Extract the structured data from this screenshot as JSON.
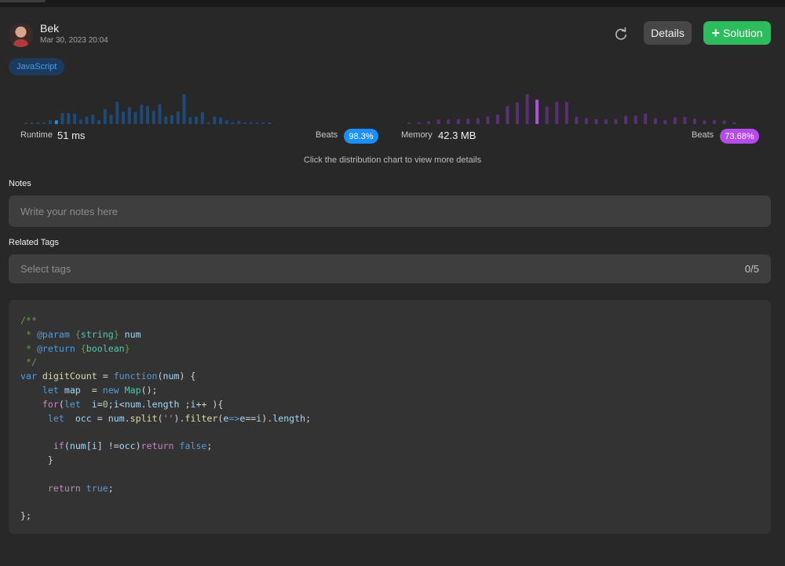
{
  "header": {
    "username": "Bek",
    "date": "Mar 30, 2023 20:04",
    "details_label": "Details",
    "solution_label": "Solution",
    "refresh_icon": "refresh-icon",
    "plus_icon": "plus-icon"
  },
  "language": "JavaScript",
  "runtime": {
    "label": "Runtime",
    "value": "51 ms",
    "beats_label": "Beats",
    "beats": "98.3%"
  },
  "memory": {
    "label": "Memory",
    "value": "42.3 MB",
    "beats_label": "Beats",
    "beats": "73.68%"
  },
  "chart_hint": "Click the distribution chart to view more details",
  "notes": {
    "label": "Notes",
    "placeholder": "Write your notes here"
  },
  "tags": {
    "label": "Related Tags",
    "placeholder": "Select tags",
    "count": "0/5"
  },
  "colors": {
    "runtime_bar": "#1e4a78",
    "runtime_highlight": "#1a90ff",
    "memory_bar": "#5b2f78",
    "memory_highlight": "#b54be8",
    "accept_green": "#2cbb5d"
  },
  "chart_data": [
    {
      "type": "bar",
      "name": "runtime-distribution",
      "values": [
        0.4,
        0.4,
        0.4,
        0.4,
        1,
        1,
        3,
        3,
        2.8,
        1.2,
        2,
        2.5,
        1,
        4,
        2.5,
        6,
        3.3,
        4.5,
        3.2,
        5.2,
        4.8,
        3.5,
        5.3,
        2,
        2.4,
        3.4,
        8,
        1.8,
        2,
        3.2,
        0.4,
        2,
        1.8,
        1,
        0.5,
        0.8,
        0.4,
        0.4,
        0.4,
        0.4,
        0.4
      ],
      "highlight_index": 5
    },
    {
      "type": "bar",
      "name": "memory-distribution",
      "values": [
        0.3,
        0.4,
        0.6,
        1,
        1,
        1.1,
        1.2,
        1.3,
        1.7,
        2.1,
        4,
        4.8,
        6.6,
        5.4,
        3.9,
        4.9,
        4.9,
        1.6,
        1.3,
        1.1,
        1,
        1.1,
        1.8,
        1.9,
        2.3,
        1.3,
        0.9,
        1.5,
        1.6,
        1.2,
        0.8,
        0.9,
        0.8,
        0.4
      ],
      "highlight_index": 13
    }
  ],
  "code": [
    [
      [
        "/**",
        "c-com"
      ]
    ],
    [
      [
        " * ",
        "c-com"
      ],
      [
        "@param",
        "c-doc"
      ],
      [
        " {",
        "c-com"
      ],
      [
        "string",
        "c-type"
      ],
      [
        "} ",
        "c-com"
      ],
      [
        "num",
        "c-var"
      ]
    ],
    [
      [
        " * ",
        "c-com"
      ],
      [
        "@return",
        "c-doc"
      ],
      [
        " {",
        "c-com"
      ],
      [
        "boolean",
        "c-type"
      ],
      [
        "}",
        "c-com"
      ]
    ],
    [
      [
        " */",
        "c-com"
      ]
    ],
    [
      [
        "var ",
        "c-kw2"
      ],
      [
        "digitCount",
        "c-fn"
      ],
      [
        " = ",
        "c-plain"
      ],
      [
        "function",
        "c-kw2"
      ],
      [
        "(",
        "c-plain"
      ],
      [
        "num",
        "c-var"
      ],
      [
        ") {",
        "c-plain"
      ]
    ],
    [
      [
        "    ",
        "c-plain"
      ],
      [
        "let ",
        "c-kw2"
      ],
      [
        "map",
        "c-var"
      ],
      [
        "  = ",
        "c-plain"
      ],
      [
        "new ",
        "c-kw2"
      ],
      [
        "Map",
        "c-type"
      ],
      [
        "();",
        "c-plain"
      ]
    ],
    [
      [
        "    ",
        "c-plain"
      ],
      [
        "for",
        "c-kw"
      ],
      [
        "(",
        "c-plain"
      ],
      [
        "let",
        "c-kw2"
      ],
      [
        "  ",
        "c-plain"
      ],
      [
        "i",
        "c-var"
      ],
      [
        "=",
        "c-plain"
      ],
      [
        "0",
        "c-num"
      ],
      [
        ";",
        "c-plain"
      ],
      [
        "i",
        "c-var"
      ],
      [
        "<",
        "c-plain"
      ],
      [
        "num",
        "c-var"
      ],
      [
        ".",
        "c-plain"
      ],
      [
        "length",
        "c-var"
      ],
      [
        " ;",
        "c-plain"
      ],
      [
        "i",
        "c-var"
      ],
      [
        "++ ){",
        "c-plain"
      ]
    ],
    [
      [
        "     ",
        "c-plain"
      ],
      [
        "let",
        "c-kw2"
      ],
      [
        "  ",
        "c-plain"
      ],
      [
        "occ",
        "c-var"
      ],
      [
        " = ",
        "c-plain"
      ],
      [
        "num",
        "c-var"
      ],
      [
        ".",
        "c-plain"
      ],
      [
        "split",
        "c-fn"
      ],
      [
        "(",
        "c-plain"
      ],
      [
        "''",
        "c-str"
      ],
      [
        ").",
        "c-plain"
      ],
      [
        "filter",
        "c-fn"
      ],
      [
        "(",
        "c-plain"
      ],
      [
        "e",
        "c-var"
      ],
      [
        "=>",
        "c-kw2"
      ],
      [
        "e",
        "c-var"
      ],
      [
        "==",
        "c-plain"
      ],
      [
        "i",
        "c-var"
      ],
      [
        ").",
        "c-plain"
      ],
      [
        "length",
        "c-var"
      ],
      [
        ";",
        "c-plain"
      ]
    ],
    [
      [
        "",
        "c-plain"
      ]
    ],
    [
      [
        "      ",
        "c-plain"
      ],
      [
        "if",
        "c-kw"
      ],
      [
        "(",
        "c-plain"
      ],
      [
        "num",
        "c-var"
      ],
      [
        "[",
        "c-plain"
      ],
      [
        "i",
        "c-var"
      ],
      [
        "] !=",
        "c-plain"
      ],
      [
        "occ",
        "c-var"
      ],
      [
        ")",
        "c-plain"
      ],
      [
        "return ",
        "c-kw"
      ],
      [
        "false",
        "c-kw2"
      ],
      [
        ";",
        "c-plain"
      ]
    ],
    [
      [
        "     }",
        "c-plain"
      ]
    ],
    [
      [
        "",
        "c-plain"
      ]
    ],
    [
      [
        "     ",
        "c-plain"
      ],
      [
        "return ",
        "c-kw"
      ],
      [
        "true",
        "c-kw2"
      ],
      [
        ";",
        "c-plain"
      ]
    ],
    [
      [
        "",
        "c-plain"
      ]
    ],
    [
      [
        "};",
        "c-plain"
      ]
    ]
  ]
}
